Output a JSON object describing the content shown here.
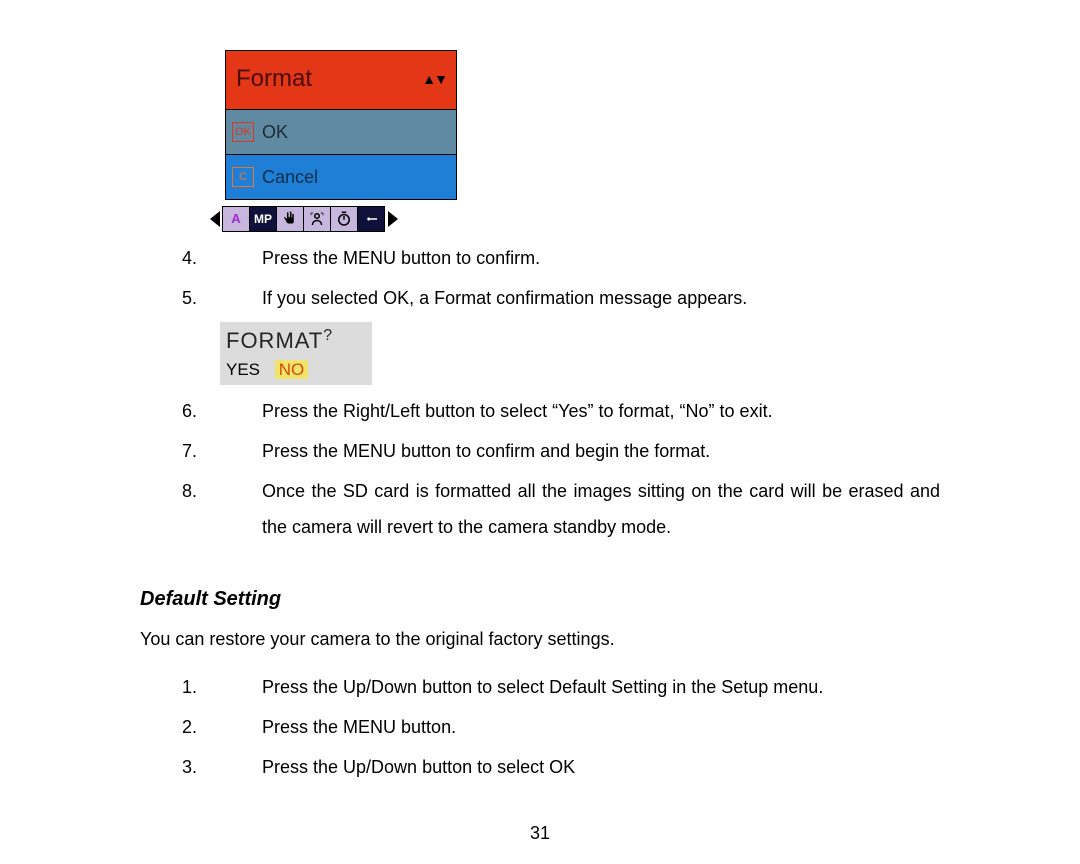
{
  "menu": {
    "title": "Format",
    "ok_key": "OK",
    "ok_label": "OK",
    "cancel_key": "C",
    "cancel_label": "Cancel",
    "strip_mp": "MP",
    "strip_aa": "A"
  },
  "steps_a": {
    "n4": "4.",
    "t4": "Press the MENU button to confirm.",
    "n5": "5.",
    "t5": "If you selected OK, a Format confirmation message appears."
  },
  "confirm": {
    "title": "FORMAT",
    "q": "?",
    "yes": "YES",
    "no": "NO"
  },
  "steps_b": {
    "n6": "6.",
    "t6": "Press the Right/Left button to select “Yes” to format, “No” to exit.",
    "n7": "7.",
    "t7": "Press the MENU button to confirm and begin the format.",
    "n8": "8.",
    "t8": "Once the SD card is formatted all the images sitting on the card will be erased and the camera will revert to the camera standby mode."
  },
  "section2": {
    "heading": "Default Setting",
    "intro": "You can restore your camera to the original factory settings.",
    "n1": "1.",
    "t1": "Press the Up/Down button to select Default Setting in the Setup menu.",
    "n2": "2.",
    "t2": "Press the MENU button.",
    "n3": "3.",
    "t3": "Press the Up/Down button to select OK"
  },
  "page_number": "31"
}
